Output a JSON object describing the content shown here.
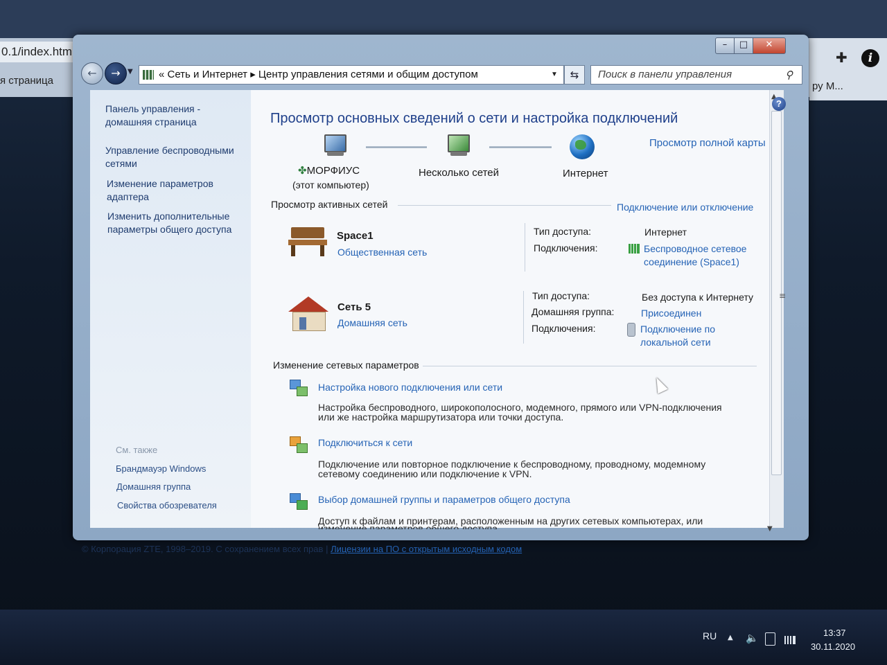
{
  "browser": {
    "address_fragment": "0.1/index.htm",
    "bookmark_fragment": "я страница",
    "right_fragment": "ру М...",
    "footer_copyright": "© Корпорация ZTE, 1998–2019. С сохранением всех прав",
    "footer_separator": "|",
    "footer_link": "Лицензии на ПО с открытым исходным кодом"
  },
  "window": {
    "controls": {
      "minimize": "–",
      "maximize": "□",
      "close": "✕"
    },
    "nav": {
      "back": "←",
      "forward": "→"
    },
    "address": {
      "text": "«  Сеть и Интернет  ▸  Центр управления сетями и общим доступом"
    },
    "search": {
      "placeholder": "Поиск в панели управления"
    }
  },
  "left_pane": {
    "home": "Панель управления - домашняя страница",
    "links": [
      "Управление беспроводными сетями",
      "Изменение параметров адаптера",
      "Изменить дополнительные параметры общего доступа"
    ],
    "see_also_title": "См. также",
    "see_also": [
      "Брандмауэр Windows",
      "Домашняя группа",
      "Свойства обозревателя"
    ]
  },
  "main": {
    "title": "Просмотр основных сведений о сети и настройка подключений",
    "map_link": "Просмотр полной карты",
    "map": {
      "computer_name": "МОРФИУС",
      "computer_sub": "(этот компьютер)",
      "middle": "Несколько сетей",
      "internet": "Интернет"
    },
    "active_title": "Просмотр активных сетей",
    "connect_link": "Подключение или отключение",
    "networks": [
      {
        "name": "Space1",
        "type": "Общественная сеть",
        "access_label": "Тип доступа:",
        "access_value": "Интернет",
        "conn_label": "Подключения:",
        "conn_value_1": "Беспроводное сетевое",
        "conn_value_2": "соединение (Space1)"
      },
      {
        "name": "Сеть  5",
        "type": "Домашняя сеть",
        "access_label": "Тип доступа:",
        "access_value": "Без доступа к Интернету",
        "homegroup_label": "Домашняя группа:",
        "homegroup_value": "Присоединен",
        "conn_label": "Подключения:",
        "conn_value_1": "Подключение по",
        "conn_value_2": "локальной сети"
      }
    ],
    "change_title": "Изменение сетевых параметров",
    "tasks": [
      {
        "link": "Настройка нового подключения или сети",
        "desc_1": "Настройка беспроводного, широкополосного, модемного, прямого или VPN-подключения",
        "desc_2": "или же настройка маршрутизатора или точки доступа."
      },
      {
        "link": "Подключиться к сети",
        "desc_1": "Подключение или повторное подключение к беспроводному, проводному, модемному",
        "desc_2": "сетевому соединению или подключение к VPN."
      },
      {
        "link": "Выбор домашней группы и параметров общего доступа",
        "desc_1": "Доступ к файлам и принтерам, расположенным на других сетевых компьютерах, или",
        "desc_2": "изменение параметров общего доступа."
      }
    ],
    "help": "?"
  },
  "taskbar": {
    "lang": "RU",
    "time": "13:37",
    "date": "30.11.2020"
  }
}
